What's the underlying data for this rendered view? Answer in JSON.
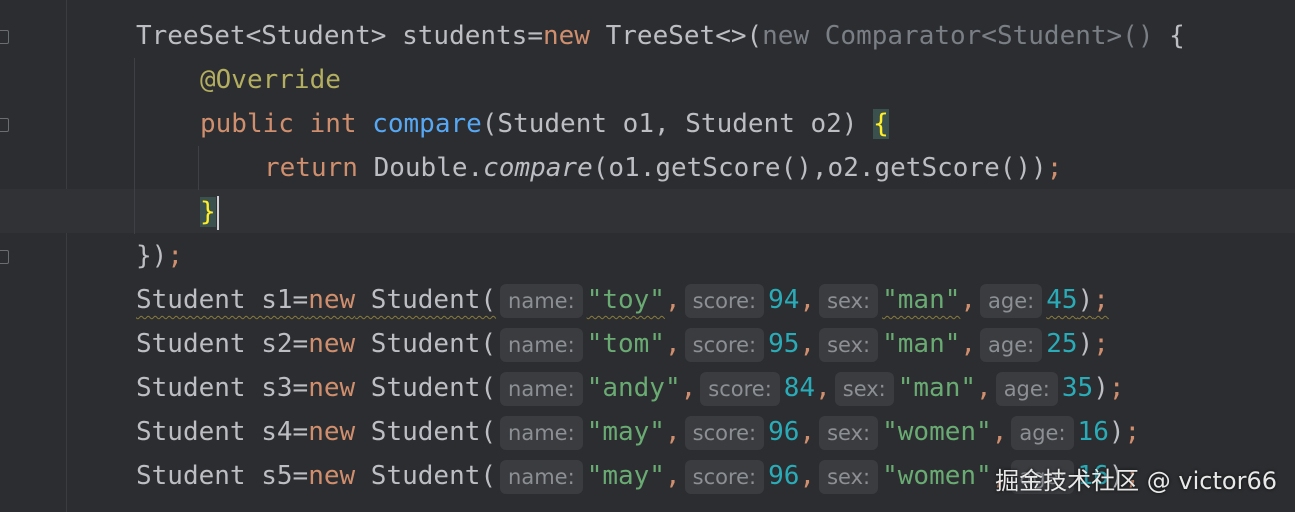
{
  "code": {
    "line1": {
      "t1": "TreeSet<Student> students=",
      "kw": "new",
      "t2": " TreeSet<>(",
      "gray": "new Comparator<Student>()",
      "t3": " {"
    },
    "line2": {
      "annotation": "@Override"
    },
    "line3": {
      "kw1": "public",
      "kw2": "int",
      "fn": "compare",
      "t1": "(Student o1, Student o2) ",
      "brace": "{"
    },
    "line4": {
      "kw": "return",
      "t1": " Double.",
      "method": "compare",
      "t2": "(o1.getScore(),o2.getScore())",
      "semi": ";"
    },
    "line5": {
      "brace": "}"
    },
    "line6": {
      "t1": "})",
      "semi": ";"
    },
    "students": [
      {
        "decl": "Student s1=",
        "kw": "new",
        "ctor": " Student(",
        "name": "\"toy\"",
        "score": "94",
        "sex": "\"man\"",
        "age": "45"
      },
      {
        "decl": "Student s2=",
        "kw": "new",
        "ctor": " Student(",
        "name": "\"tom\"",
        "score": "95",
        "sex": "\"man\"",
        "age": "25"
      },
      {
        "decl": "Student s3=",
        "kw": "new",
        "ctor": " Student(",
        "name": "\"andy\"",
        "score": "84",
        "sex": "\"man\"",
        "age": "35"
      },
      {
        "decl": "Student s4=",
        "kw": "new",
        "ctor": " Student(",
        "name": "\"may\"",
        "score": "96",
        "sex": "\"women\"",
        "age": "16"
      },
      {
        "decl": "Student s5=",
        "kw": "new",
        "ctor": " Student(",
        "name": "\"may\"",
        "score": "96",
        "sex": "\"women\"",
        "age": "16"
      }
    ],
    "hints": {
      "name": "name:",
      "score": "score:",
      "sex": "sex:",
      "age": "age:"
    },
    "punct": {
      "comma": ",",
      "close": ")",
      "semi": ";"
    }
  },
  "watermark": "掘金技术社区 @ victor66",
  "colors": {
    "background": "#2b2d30",
    "keyword": "#cf8e6d",
    "string": "#6aab73",
    "number": "#2aacb8",
    "method": "#56a8f5",
    "annotation": "#b3ae60"
  }
}
